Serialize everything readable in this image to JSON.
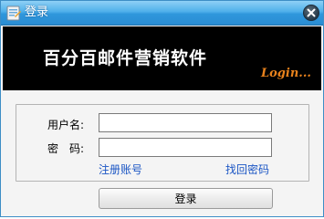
{
  "window": {
    "title": "登录",
    "close_icon": "close-icon"
  },
  "banner": {
    "title": "百分百邮件营销软件",
    "login_text": "Login..."
  },
  "form": {
    "username_label": "用户名:",
    "username_value": "",
    "password_label": "密　码:",
    "password_value": "",
    "register_link": "注册账号",
    "recover_link": "找回密码"
  },
  "actions": {
    "login_label": "登录"
  },
  "colors": {
    "titlebar": "#3aa3e4",
    "banner_bg": "#000000",
    "banner_text": "#ffffff",
    "login_accent": "#e8821c",
    "link": "#1a55c4"
  }
}
